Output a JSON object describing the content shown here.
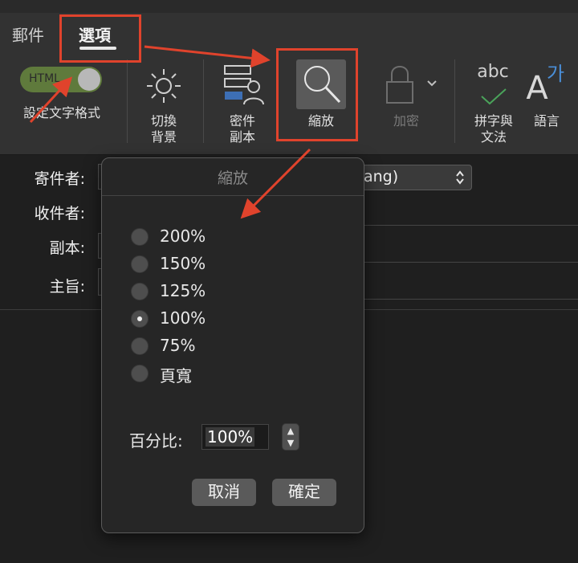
{
  "tabs": {
    "mail": "郵件",
    "options": "選項"
  },
  "ribbon": {
    "format_toggle_text": "HTML",
    "format_label": "設定文字格式",
    "background_label_1": "切換",
    "background_label_2": "背景",
    "bcc_label_1": "密件",
    "bcc_label_2": "副本",
    "zoom_label": "縮放",
    "encrypt_label": "加密",
    "spelling_glyph": "abc",
    "spelling_label_1": "拼字與",
    "spelling_label_2": "文法",
    "language_glyph_a": "A",
    "language_glyph_ga": "가",
    "language_label": "語言"
  },
  "compose": {
    "from_label": "寄件者:",
    "to_label": "收件者:",
    "cc_label": "副本:",
    "subject_label": "主旨:",
    "from_value_fragment": "ang)"
  },
  "zoom_dialog": {
    "title": "縮放",
    "options": [
      "200%",
      "150%",
      "125%",
      "100%",
      "75%",
      "頁寬"
    ],
    "selected": "100%",
    "percent_label": "百分比:",
    "percent_value": "100%",
    "cancel": "取消",
    "ok": "確定"
  },
  "colors": {
    "annotation_red": "#e0432c",
    "toggle_green": "#5f7a3c",
    "blue_accent": "#3d6fb5"
  }
}
